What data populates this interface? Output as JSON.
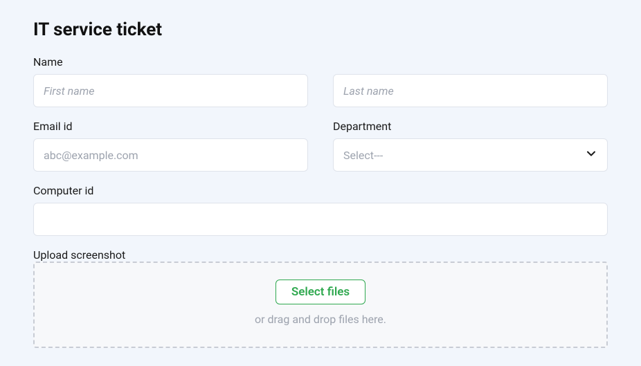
{
  "title": "IT service ticket",
  "fields": {
    "name": {
      "label": "Name",
      "first_placeholder": "First name",
      "last_placeholder": "Last name"
    },
    "email": {
      "label": "Email id",
      "placeholder": "abc@example.com"
    },
    "department": {
      "label": "Department",
      "placeholder": "Select---"
    },
    "computer_id": {
      "label": "Computer id"
    },
    "upload": {
      "label": "Upload screenshot",
      "button": "Select files",
      "hint": "or drag and drop files here."
    }
  }
}
